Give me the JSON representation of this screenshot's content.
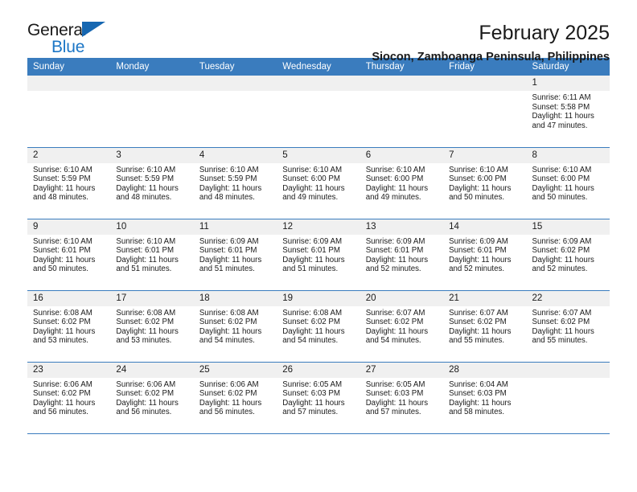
{
  "logo": {
    "primary_text": "General",
    "secondary_text": "Blue",
    "triangle_icon": "blue-triangle-icon",
    "primary_color": "#1a1a1a",
    "secondary_color": "#1b76c6"
  },
  "header": {
    "title": "February 2025",
    "subtitle": "Siocon, Zamboanga Peninsula, Philippines"
  },
  "theme": {
    "accent": "#3a7cbe",
    "daynum_band": "#f0f0f0",
    "text": "#1a1a1a"
  },
  "calendar": {
    "weekday_headers": [
      "Sunday",
      "Monday",
      "Tuesday",
      "Wednesday",
      "Thursday",
      "Friday",
      "Saturday"
    ],
    "weeks": [
      [
        {
          "day": "",
          "sunrise": "",
          "sunset": "",
          "daylight_line1": "",
          "daylight_line2": ""
        },
        {
          "day": "",
          "sunrise": "",
          "sunset": "",
          "daylight_line1": "",
          "daylight_line2": ""
        },
        {
          "day": "",
          "sunrise": "",
          "sunset": "",
          "daylight_line1": "",
          "daylight_line2": ""
        },
        {
          "day": "",
          "sunrise": "",
          "sunset": "",
          "daylight_line1": "",
          "daylight_line2": ""
        },
        {
          "day": "",
          "sunrise": "",
          "sunset": "",
          "daylight_line1": "",
          "daylight_line2": ""
        },
        {
          "day": "",
          "sunrise": "",
          "sunset": "",
          "daylight_line1": "",
          "daylight_line2": ""
        },
        {
          "day": "1",
          "sunrise": "Sunrise: 6:11 AM",
          "sunset": "Sunset: 5:58 PM",
          "daylight_line1": "Daylight: 11 hours",
          "daylight_line2": "and 47 minutes."
        }
      ],
      [
        {
          "day": "2",
          "sunrise": "Sunrise: 6:10 AM",
          "sunset": "Sunset: 5:59 PM",
          "daylight_line1": "Daylight: 11 hours",
          "daylight_line2": "and 48 minutes."
        },
        {
          "day": "3",
          "sunrise": "Sunrise: 6:10 AM",
          "sunset": "Sunset: 5:59 PM",
          "daylight_line1": "Daylight: 11 hours",
          "daylight_line2": "and 48 minutes."
        },
        {
          "day": "4",
          "sunrise": "Sunrise: 6:10 AM",
          "sunset": "Sunset: 5:59 PM",
          "daylight_line1": "Daylight: 11 hours",
          "daylight_line2": "and 48 minutes."
        },
        {
          "day": "5",
          "sunrise": "Sunrise: 6:10 AM",
          "sunset": "Sunset: 6:00 PM",
          "daylight_line1": "Daylight: 11 hours",
          "daylight_line2": "and 49 minutes."
        },
        {
          "day": "6",
          "sunrise": "Sunrise: 6:10 AM",
          "sunset": "Sunset: 6:00 PM",
          "daylight_line1": "Daylight: 11 hours",
          "daylight_line2": "and 49 minutes."
        },
        {
          "day": "7",
          "sunrise": "Sunrise: 6:10 AM",
          "sunset": "Sunset: 6:00 PM",
          "daylight_line1": "Daylight: 11 hours",
          "daylight_line2": "and 50 minutes."
        },
        {
          "day": "8",
          "sunrise": "Sunrise: 6:10 AM",
          "sunset": "Sunset: 6:00 PM",
          "daylight_line1": "Daylight: 11 hours",
          "daylight_line2": "and 50 minutes."
        }
      ],
      [
        {
          "day": "9",
          "sunrise": "Sunrise: 6:10 AM",
          "sunset": "Sunset: 6:01 PM",
          "daylight_line1": "Daylight: 11 hours",
          "daylight_line2": "and 50 minutes."
        },
        {
          "day": "10",
          "sunrise": "Sunrise: 6:10 AM",
          "sunset": "Sunset: 6:01 PM",
          "daylight_line1": "Daylight: 11 hours",
          "daylight_line2": "and 51 minutes."
        },
        {
          "day": "11",
          "sunrise": "Sunrise: 6:09 AM",
          "sunset": "Sunset: 6:01 PM",
          "daylight_line1": "Daylight: 11 hours",
          "daylight_line2": "and 51 minutes."
        },
        {
          "day": "12",
          "sunrise": "Sunrise: 6:09 AM",
          "sunset": "Sunset: 6:01 PM",
          "daylight_line1": "Daylight: 11 hours",
          "daylight_line2": "and 51 minutes."
        },
        {
          "day": "13",
          "sunrise": "Sunrise: 6:09 AM",
          "sunset": "Sunset: 6:01 PM",
          "daylight_line1": "Daylight: 11 hours",
          "daylight_line2": "and 52 minutes."
        },
        {
          "day": "14",
          "sunrise": "Sunrise: 6:09 AM",
          "sunset": "Sunset: 6:01 PM",
          "daylight_line1": "Daylight: 11 hours",
          "daylight_line2": "and 52 minutes."
        },
        {
          "day": "15",
          "sunrise": "Sunrise: 6:09 AM",
          "sunset": "Sunset: 6:02 PM",
          "daylight_line1": "Daylight: 11 hours",
          "daylight_line2": "and 52 minutes."
        }
      ],
      [
        {
          "day": "16",
          "sunrise": "Sunrise: 6:08 AM",
          "sunset": "Sunset: 6:02 PM",
          "daylight_line1": "Daylight: 11 hours",
          "daylight_line2": "and 53 minutes."
        },
        {
          "day": "17",
          "sunrise": "Sunrise: 6:08 AM",
          "sunset": "Sunset: 6:02 PM",
          "daylight_line1": "Daylight: 11 hours",
          "daylight_line2": "and 53 minutes."
        },
        {
          "day": "18",
          "sunrise": "Sunrise: 6:08 AM",
          "sunset": "Sunset: 6:02 PM",
          "daylight_line1": "Daylight: 11 hours",
          "daylight_line2": "and 54 minutes."
        },
        {
          "day": "19",
          "sunrise": "Sunrise: 6:08 AM",
          "sunset": "Sunset: 6:02 PM",
          "daylight_line1": "Daylight: 11 hours",
          "daylight_line2": "and 54 minutes."
        },
        {
          "day": "20",
          "sunrise": "Sunrise: 6:07 AM",
          "sunset": "Sunset: 6:02 PM",
          "daylight_line1": "Daylight: 11 hours",
          "daylight_line2": "and 54 minutes."
        },
        {
          "day": "21",
          "sunrise": "Sunrise: 6:07 AM",
          "sunset": "Sunset: 6:02 PM",
          "daylight_line1": "Daylight: 11 hours",
          "daylight_line2": "and 55 minutes."
        },
        {
          "day": "22",
          "sunrise": "Sunrise: 6:07 AM",
          "sunset": "Sunset: 6:02 PM",
          "daylight_line1": "Daylight: 11 hours",
          "daylight_line2": "and 55 minutes."
        }
      ],
      [
        {
          "day": "23",
          "sunrise": "Sunrise: 6:06 AM",
          "sunset": "Sunset: 6:02 PM",
          "daylight_line1": "Daylight: 11 hours",
          "daylight_line2": "and 56 minutes."
        },
        {
          "day": "24",
          "sunrise": "Sunrise: 6:06 AM",
          "sunset": "Sunset: 6:02 PM",
          "daylight_line1": "Daylight: 11 hours",
          "daylight_line2": "and 56 minutes."
        },
        {
          "day": "25",
          "sunrise": "Sunrise: 6:06 AM",
          "sunset": "Sunset: 6:02 PM",
          "daylight_line1": "Daylight: 11 hours",
          "daylight_line2": "and 56 minutes."
        },
        {
          "day": "26",
          "sunrise": "Sunrise: 6:05 AM",
          "sunset": "Sunset: 6:03 PM",
          "daylight_line1": "Daylight: 11 hours",
          "daylight_line2": "and 57 minutes."
        },
        {
          "day": "27",
          "sunrise": "Sunrise: 6:05 AM",
          "sunset": "Sunset: 6:03 PM",
          "daylight_line1": "Daylight: 11 hours",
          "daylight_line2": "and 57 minutes."
        },
        {
          "day": "28",
          "sunrise": "Sunrise: 6:04 AM",
          "sunset": "Sunset: 6:03 PM",
          "daylight_line1": "Daylight: 11 hours",
          "daylight_line2": "and 58 minutes."
        },
        {
          "day": "",
          "sunrise": "",
          "sunset": "",
          "daylight_line1": "",
          "daylight_line2": ""
        }
      ]
    ]
  }
}
